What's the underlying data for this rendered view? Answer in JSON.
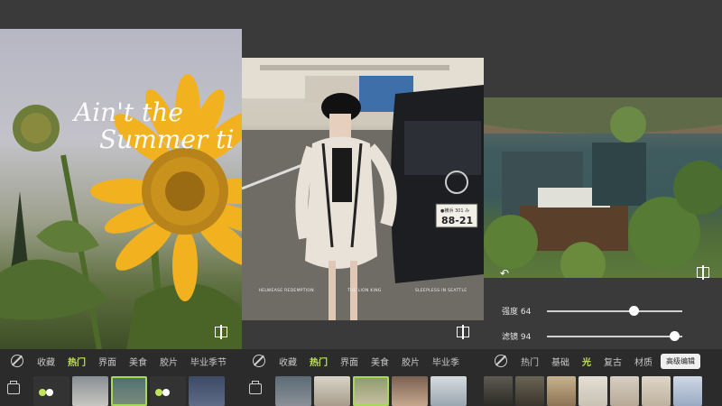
{
  "panel1": {
    "overlay_script": [
      "Ain't the",
      "Summer ti"
    ],
    "tabs": [
      "收藏",
      "热门",
      "界面",
      "美食",
      "胶片",
      "毕业季节"
    ],
    "active_tab": "热门"
  },
  "panel2": {
    "plate": {
      "top": "●横浜 301 み",
      "number": "88-21"
    },
    "credits": [
      "HELWEASE REDEMPTION",
      "THE LION KING",
      "SLEEPLESS IN SEATTLE"
    ],
    "tabs": [
      "收藏",
      "热门",
      "界面",
      "美食",
      "胶片",
      "毕业季"
    ],
    "active_tab": "热门"
  },
  "panel3": {
    "sliders": [
      {
        "label": "强度 64",
        "value": 64
      },
      {
        "label": "滤镜 94",
        "value": 94
      }
    ],
    "tabs": [
      "热门",
      "基础",
      "光",
      "复古",
      "材质"
    ],
    "active_tab": "光",
    "advanced_button": "高级编辑"
  },
  "colors": {
    "accent": "#bfe45a",
    "toolbar_bg": "#2b2b2b",
    "canvas_bg": "#3a3a3a"
  }
}
